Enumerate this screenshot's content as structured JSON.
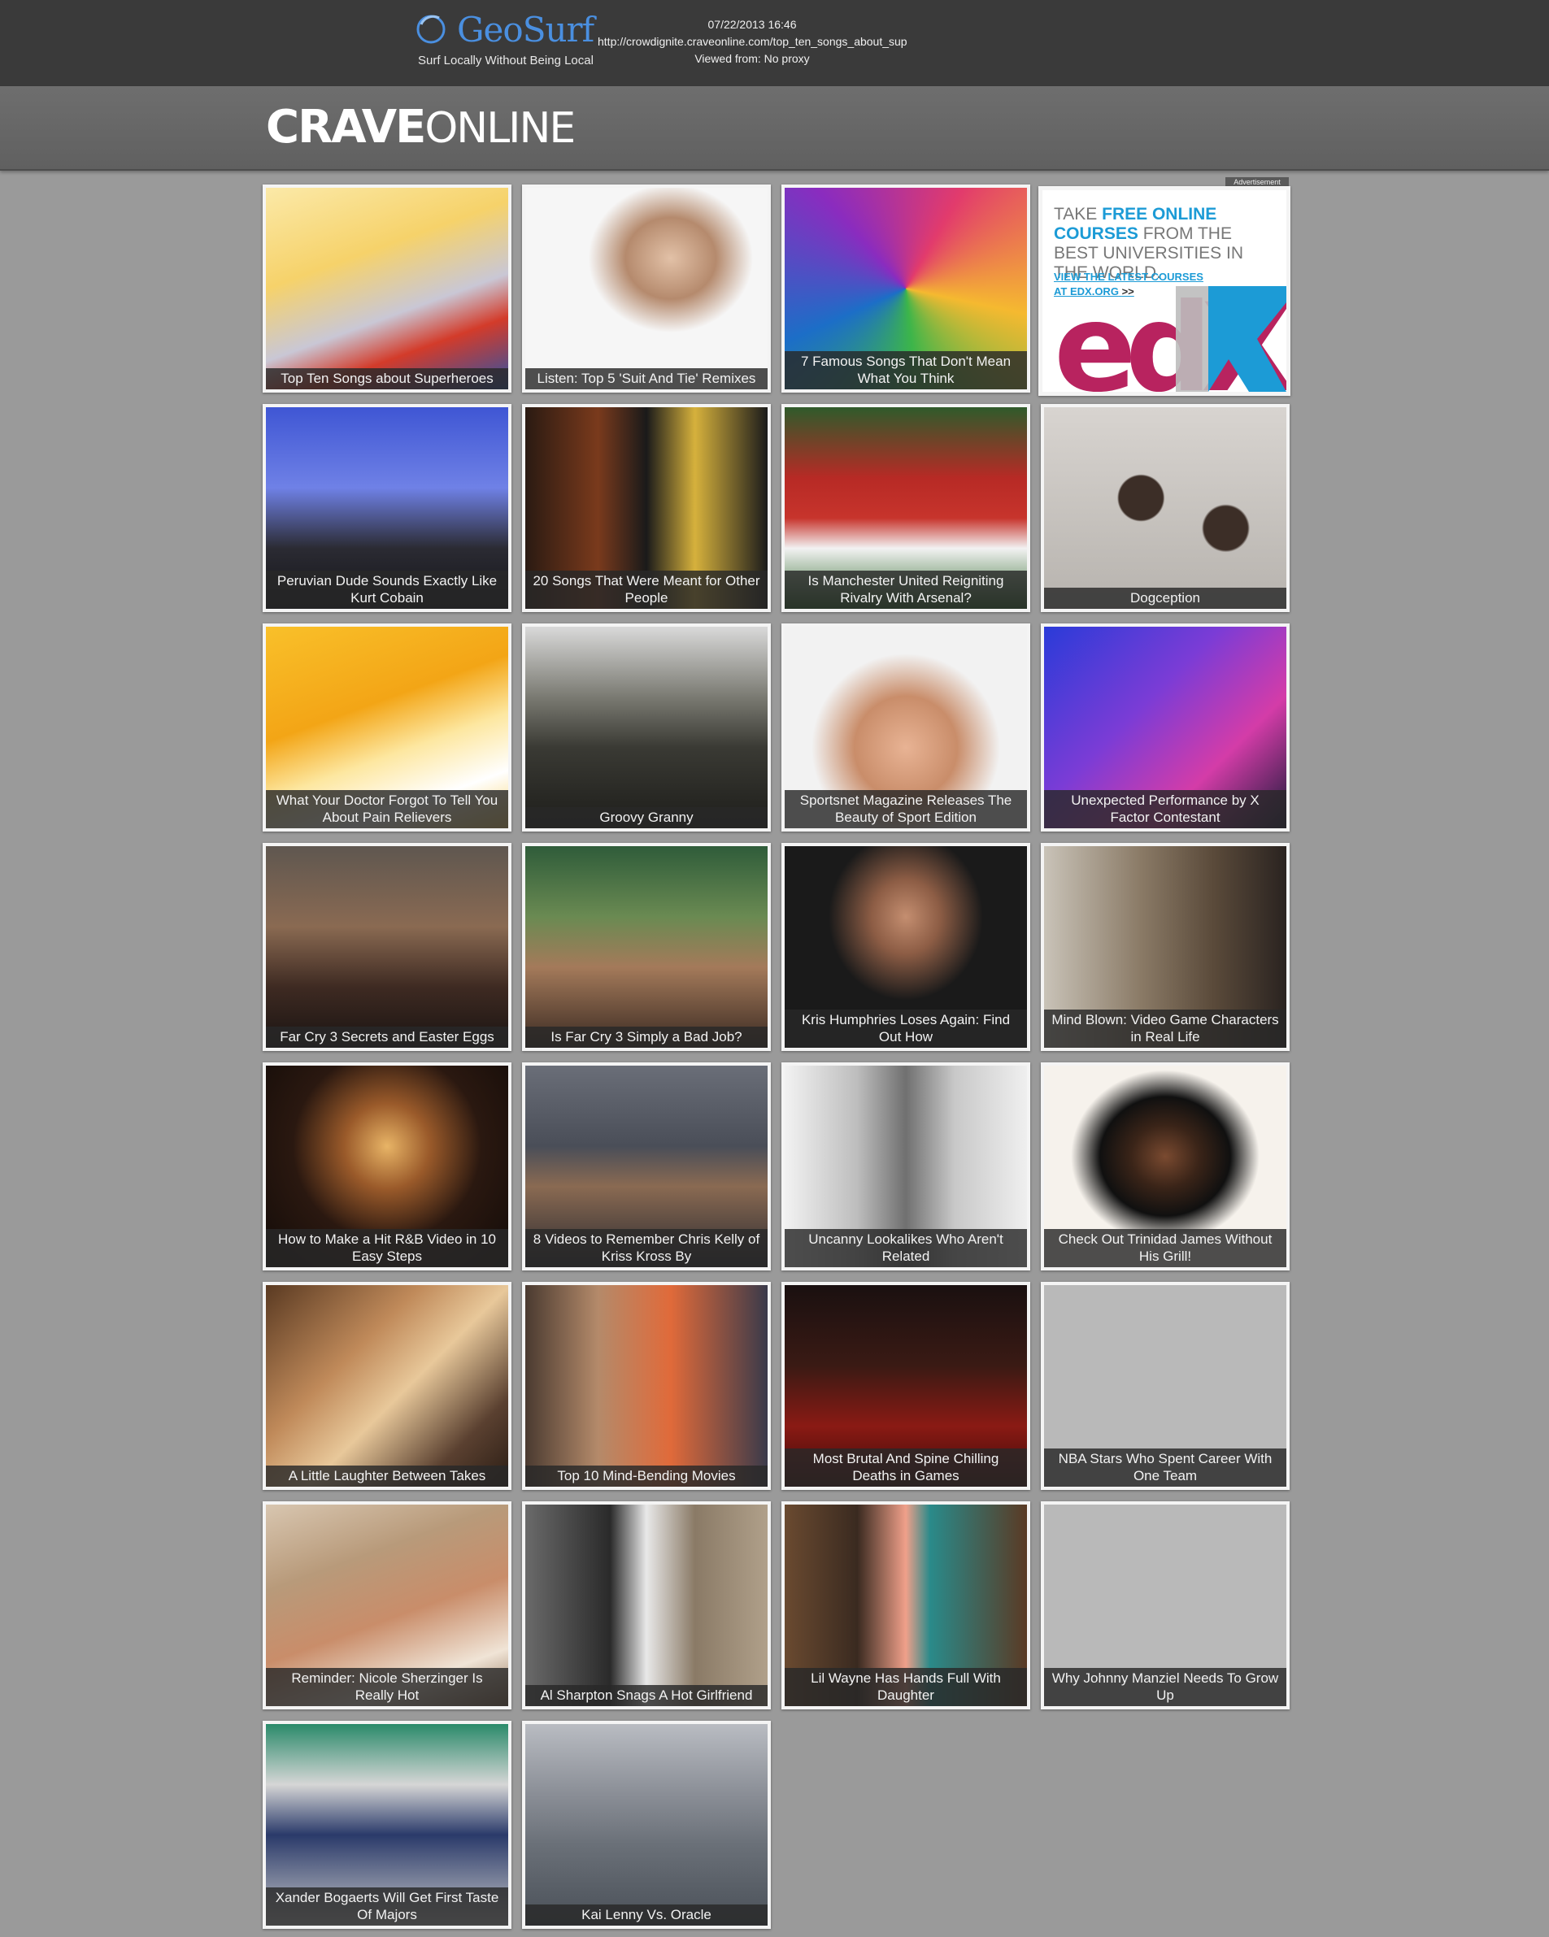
{
  "proxy_bar": {
    "logo_text": "GeoSurf",
    "tagline": "Surf Locally Without Being Local",
    "timestamp": "07/22/2013 16:46",
    "url": "http://crowdignite.craveonline.com/top_ten_songs_about_super..",
    "viewed_from": "Viewed from: No proxy"
  },
  "site": {
    "logo_bold": "CRAVE",
    "logo_light": "ONLINE"
  },
  "ad": {
    "label": "Advertisement",
    "line_take": "TAKE ",
    "line_free": "FREE ONLINE COURSES",
    "line_rest": " FROM THE BEST UNIVERSITIES IN THE WORLD.",
    "link_line1": "VIEW THE LATEST COURSES",
    "link_line2": "AT EDX.ORG",
    "link_arrow": ">>",
    "logo_text": "edX"
  },
  "tiles": [
    {
      "caption": "Top Ten Songs about Superheroes",
      "image": "superhero-illustration",
      "bg": "linear-gradient(160deg,#fbe9a8 0%,#f6d26a 35%,#c9c7d5 60%,#d33b2a 75%,#2a53a8 100%)"
    },
    {
      "caption": "Listen: Top 5 'Suit And Tie' Remixes",
      "image": "man-in-suit-portrait",
      "bg": "radial-gradient(ellipse at 60% 35%,#e2c1a7 0%,#b58a6d 22%,#f6f6f6 40%),linear-gradient(#ffffff,#2c2c2c)"
    },
    {
      "caption": "7 Famous Songs That Don't Mean What You Think",
      "image": "psychedelic-art",
      "bg": "conic-gradient(from 30deg,#e23b6c,#f5b930,#3cb54a,#1c6ec7,#8a2cbf,#e23b6c)"
    },
    {
      "caption": "Peruvian Dude Sounds Exactly Like Kurt Cobain",
      "image": "long-haired-singer",
      "bg": "linear-gradient(180deg,#3f56d4 0%,#6f81e6 40%,#2b2b33 70%,#141418 100%)"
    },
    {
      "caption": "20 Songs That Were Meant for Other People",
      "image": "concert-performers",
      "bg": "linear-gradient(90deg,#2a1a12 0%,#7a3a1c 30%,#1a1a1a 50%,#d6b13c 70%,#1b1b1b 100%)"
    },
    {
      "caption": "Is Manchester United Reigniting Rivalry With Arsenal?",
      "image": "soccer-players",
      "bg": "linear-gradient(180deg,#2f5b2b 0%,#b72a25 35%,#c7342c 55%,#f2f2f2 70%,#2f6a2c 100%)"
    },
    {
      "caption": "Dogception",
      "image": "dog-fur-closeup",
      "bg": "radial-gradient(circle at 40% 45%,#3c2e27 0 12%,transparent 13%),radial-gradient(circle at 75% 60%,#3c2e27 0 10%,transparent 11%),linear-gradient(#d8d4d0,#b7b3ae)"
    },
    {
      "caption": "What Your Doctor Forgot To Tell You About Pain Relievers",
      "image": "pill-bottles",
      "bg": "linear-gradient(160deg,#f9c02a 0%,#f3a516 40%,#fde7a0 60%,#ffffff 80%,#f7d26a 100%)"
    },
    {
      "caption": "Groovy Granny",
      "image": "granny-drummer",
      "bg": "linear-gradient(180deg,#d9d9d9 0%,#7a7a72 35%,#3a3a34 60%,#1d1d1a 100%)"
    },
    {
      "caption": "Sportsnet Magazine Releases The Beauty of Sport Edition",
      "image": "smiling-cyclist",
      "bg": "radial-gradient(ellipse at 50% 60%,#e8b394 0%,#c98d6a 30%,#f2f2f2 55%),linear-gradient(#dcdcdc,#f7f7f7)"
    },
    {
      "caption": "Unexpected Performance by X Factor Contestant",
      "image": "xfactor-contestant",
      "bg": "linear-gradient(135deg,#2a3bd8 0%,#7b3cd6 40%,#d43ca8 70%,#1b1b3a 100%)"
    },
    {
      "caption": "Far Cry 3 Secrets and Easter Eggs",
      "image": "game-character-woman",
      "bg": "linear-gradient(180deg,#5f5750 0%,#8a6a52 40%,#3e2a22 70%,#1a1412 100%)"
    },
    {
      "caption": "Is Far Cry 3 Simply a Bad Job?",
      "image": "game-character-mohawk",
      "bg": "linear-gradient(180deg,#2f5c3a 0%,#6a8a52 35%,#a47a5a 60%,#3a2a22 100%)"
    },
    {
      "caption": "Kris Humphries Loses Again: Find Out How",
      "image": "man-portrait-dark",
      "bg": "radial-gradient(ellipse at 50% 35%,#c48e70 0%,#8d5d45 20%,#1a1a1a 45%),linear-gradient(#111,#222)"
    },
    {
      "caption": "Mind Blown: Video Game Characters in Real Life",
      "image": "game-character-man",
      "bg": "linear-gradient(90deg,#c9c3b8 0%,#8a7a66 40%,#5a4a3a 70%,#2a2320 100%)"
    },
    {
      "caption": "How to Make a Hit R&B Video in 10 Easy Steps",
      "image": "silhouette-doorway",
      "bg": "radial-gradient(ellipse at 50% 40%,#e8b466 0%,#9a5a2a 25%,#2a1810 55%,#120b08 100%)"
    },
    {
      "caption": "8 Videos to Remember Chris Kelly of Kriss Kross By",
      "image": "rapper-car",
      "bg": "linear-gradient(180deg,#6a6e78 0%,#4a4e58 40%,#8a6a52 60%,#2a2a30 100%)"
    },
    {
      "caption": "Uncanny Lookalikes Who Aren't Related",
      "image": "twin-girls-bw",
      "bg": "linear-gradient(90deg,#f2f2f2 0%,#bdbdbd 30%,#707070 50%,#c8c8c8 70%,#efefef 100%)"
    },
    {
      "caption": "Check Out Trinidad James Without His Grill!",
      "image": "man-afro-glasses",
      "bg": "radial-gradient(ellipse at 50% 45%,#7a4a30 0%,#3a2418 20%,#101010 38%,#f6f2ec 55%),linear-gradient(#fff,#f0e8df)"
    },
    {
      "caption": "A Little Laughter Between Takes",
      "image": "actors-laughing",
      "bg": "linear-gradient(135deg,#5a3a22 0%,#c08a5a 35%,#e8c89a 55%,#5a4030 80%,#2a1d14 100%)"
    },
    {
      "caption": "Top 10 Mind-Bending Movies",
      "image": "movie-couple",
      "bg": "linear-gradient(90deg,#4a3a30 0%,#b48a6a 30%,#e06a3a 60%,#3a3a4a 100%)"
    },
    {
      "caption": "Most Brutal And Spine Chilling Deaths in Games",
      "image": "game-scene-red",
      "bg": "linear-gradient(180deg,#1a1010 0%,#3a1a14 40%,#8a1a14 70%,#3a0a08 100%)"
    },
    {
      "caption": "NBA Stars Who Spent Career With One Team",
      "image": "blank-image",
      "bg": "#b9b9b9"
    },
    {
      "caption": "Reminder: Nicole Sherzinger Is Really Hot",
      "image": "woman-portrait",
      "bg": "linear-gradient(160deg,#d8c6b0 0%,#b89a7a 30%,#c98d6a 55%,#f0e4d6 80%,#8a6a50 100%)"
    },
    {
      "caption": "Al Sharpton Snags A Hot Girlfriend",
      "image": "man-in-suit-street",
      "bg": "linear-gradient(90deg,#6a6a6a 0%,#2a2a2a 35%,#e8e8e8 50%,#8a7a66 70%,#b0a08a 100%)"
    },
    {
      "caption": "Lil Wayne Has Hands Full With Daughter",
      "image": "woman-bookstore",
      "bg": "linear-gradient(90deg,#6a4a30 0%,#3a2a20 30%,#f0a08a 50%,#2a8a8a 60%,#5a3a24 100%)"
    },
    {
      "caption": "Why Johnny Manziel Needs To Grow Up",
      "image": "blank-image",
      "bg": "#b9b9b9"
    },
    {
      "caption": "Xander Bogaerts Will Get First Taste Of Majors",
      "image": "baseball-player",
      "bg": "linear-gradient(180deg,#2a8a6a 0%,#d6d6d6 30%,#2a3a6a 55%,#c8c8c8 100%)"
    },
    {
      "caption": "Kai Lenny Vs. Oracle",
      "image": "sailing-boat",
      "bg": "linear-gradient(180deg,#b9bcc2 0%,#8a8e96 35%,#6a7078 60%,#4a5058 100%)"
    }
  ]
}
